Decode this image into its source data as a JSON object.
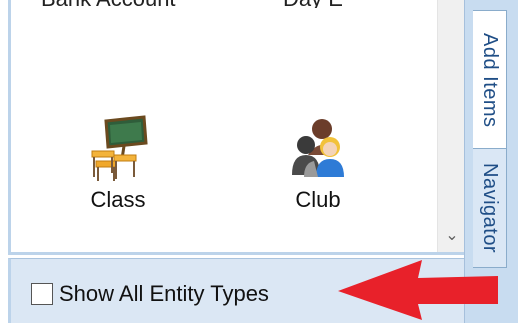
{
  "panel": {
    "cut_text_left": "Bank Account",
    "cut_text_right": "Day E",
    "entities": [
      {
        "label": "Class",
        "icon": "classroom-icon"
      },
      {
        "label": "Club",
        "icon": "group-people-icon"
      }
    ]
  },
  "scrollbar": {
    "down_arrow": "⌄"
  },
  "tabs": [
    {
      "label": "Add Items",
      "selected": true
    },
    {
      "label": "Navigator",
      "selected": false
    }
  ],
  "bottom": {
    "checkbox_label": "Show All Entity Types",
    "checked": false
  },
  "colors": {
    "tab_strip": "#c8dcf0",
    "tab_text": "#1f4e86",
    "arrow": "#e8212a",
    "bottom_bar": "#dbe7f4"
  }
}
